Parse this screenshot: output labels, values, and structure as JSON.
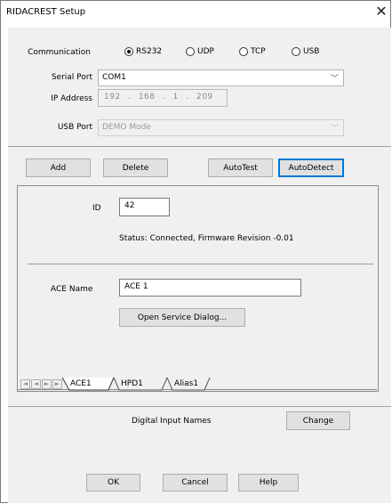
{
  "window": {
    "title": "RIDACREST Setup",
    "close_glyph": "✕"
  },
  "communication": {
    "label": "Communication",
    "options": [
      "RS232",
      "UDP",
      "TCP",
      "USB"
    ],
    "selected": "RS232"
  },
  "serial_port": {
    "label": "Serial Port",
    "value": "COM1"
  },
  "ip_address": {
    "label": "IP Address",
    "octets": [
      "192",
      "168",
      "1",
      "209"
    ],
    "dot": "."
  },
  "usb_port": {
    "label": "USB Port",
    "value": "DEMO Mode"
  },
  "toolbar": {
    "add": "Add",
    "delete": "Delete",
    "autotest": "AutoTest",
    "autodetect": "AutoDetect"
  },
  "device": {
    "id_label": "ID",
    "id_value": "42",
    "status": "Status: Connected, Firmware Revision -0.01",
    "ace_name_label": "ACE Name",
    "ace_name_value": "ACE 1",
    "open_service": "Open Service Dialog..."
  },
  "tabs": {
    "items": [
      "ACE1",
      "HPD1",
      "Alias1"
    ],
    "selected": "ACE1"
  },
  "digital_inputs": {
    "label": "Digital Input Names",
    "change": "Change"
  },
  "footer": {
    "ok": "OK",
    "cancel": "Cancel",
    "help": "Help"
  },
  "icons": {
    "nav_first": "first-icon",
    "nav_prev": "prev-icon",
    "nav_next": "next-icon",
    "nav_last": "last-icon",
    "dropdown": "chevron-down-icon",
    "close": "close-icon"
  }
}
